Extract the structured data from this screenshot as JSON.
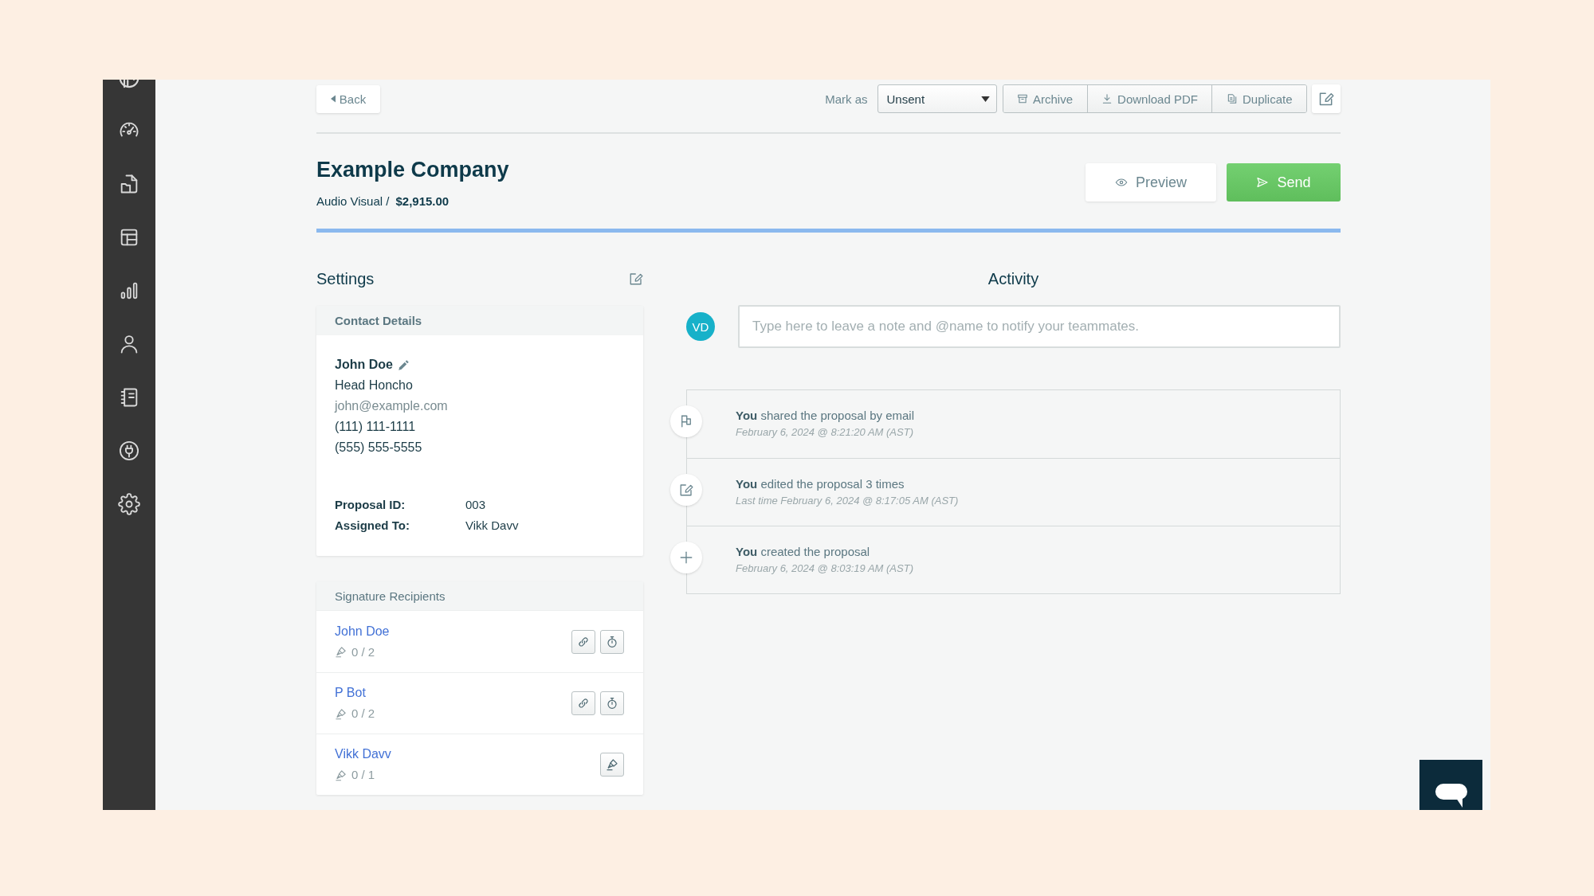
{
  "toolbar": {
    "back": "Back",
    "mark_as": {
      "label": "Mark as",
      "value": "Unsent"
    },
    "actions": [
      {
        "kind": "archive",
        "label": "Archive"
      },
      {
        "kind": "download",
        "label": "Download PDF"
      },
      {
        "kind": "duplicate",
        "label": "Duplicate"
      }
    ]
  },
  "header": {
    "title": "Example Company",
    "category": "Audio Visual /",
    "amount": "$2,915.00",
    "preview": "Preview",
    "send": "Send"
  },
  "settings": {
    "title": "Settings",
    "contact": {
      "heading": "Contact Details",
      "name": "John Doe",
      "job_title": "Head Honcho",
      "email": "john@example.com",
      "phones": [
        "(111) 111-1111",
        "(555) 555-5555"
      ],
      "details": [
        {
          "label": "Proposal ID:",
          "value": "003"
        },
        {
          "label": "Assigned To:",
          "value": "Vikk Davv"
        }
      ]
    },
    "signature_recipients": {
      "heading": "Signature Recipients",
      "recipients": [
        {
          "name": "John Doe",
          "progress": "0 / 2",
          "actions": [
            {
              "kind": "link"
            },
            {
              "kind": "timer"
            }
          ]
        },
        {
          "name": "P Bot",
          "progress": "0 / 2",
          "actions": [
            {
              "kind": "link"
            },
            {
              "kind": "timer"
            }
          ]
        },
        {
          "name": "Vikk Davv",
          "progress": "0 / 1",
          "actions": [
            {
              "kind": "sign"
            }
          ]
        }
      ]
    }
  },
  "activity": {
    "title": "Activity",
    "avatar": "VD",
    "note": {
      "placeholder": "Type here to leave a note and @name to notify your teammates."
    },
    "events": [
      {
        "kind": "shared",
        "text": "**You** shared the proposal by email",
        "time": "February 6, 2024 @ 8:21:20 AM (AST)"
      },
      {
        "kind": "edited",
        "text": "**You** edited the proposal 3 times",
        "time": "Last time February 6, 2024 @ 8:17:05 AM (AST)"
      },
      {
        "kind": "created",
        "text": "**You** created the proposal",
        "time": "February 6, 2024 @ 8:03:19 AM (AST)"
      }
    ]
  }
}
